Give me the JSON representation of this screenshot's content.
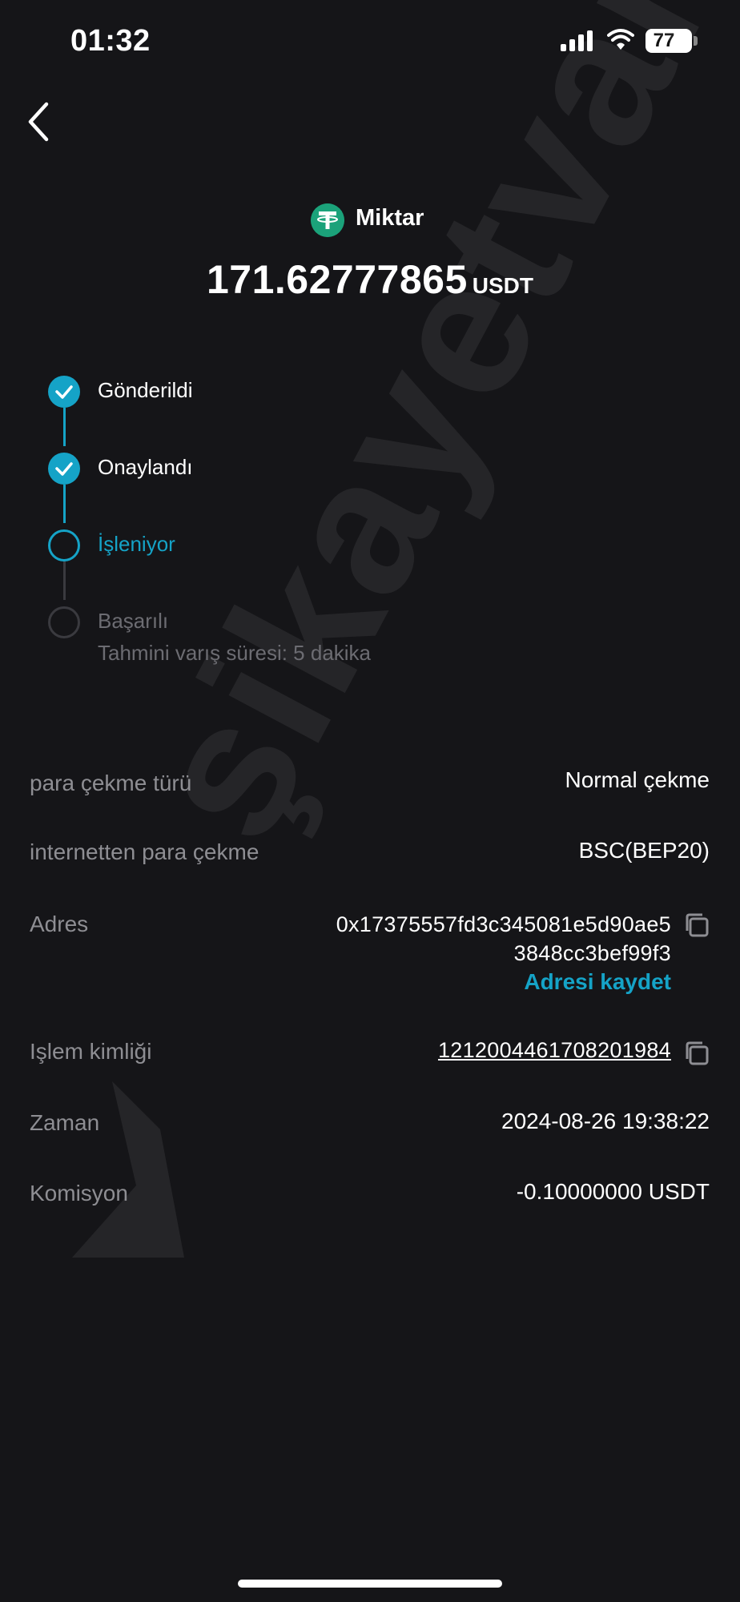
{
  "status_bar": {
    "time": "01:32",
    "battery": "77"
  },
  "header": {
    "coin_label": "Miktar",
    "amount": "171.62777865",
    "unit": "USDT"
  },
  "steps": [
    {
      "label": "Gönderildi",
      "state": "done"
    },
    {
      "label": "Onaylandı",
      "state": "done"
    },
    {
      "label": "İşleniyor",
      "state": "active"
    },
    {
      "label": "Başarılı",
      "sub": "Tahmini varış süresi: 5 dakika",
      "state": "pending"
    }
  ],
  "details": {
    "withdraw_type": {
      "label": "para çekme türü",
      "value": "Normal çekme"
    },
    "network": {
      "label": "internetten para çekme",
      "value": "BSC(BEP20)"
    },
    "address": {
      "label": "Adres",
      "line1": "0x17375557fd3c345081e5d90ae5",
      "line2": "3848cc3bef99f3",
      "save_label": "Adresi kaydet"
    },
    "tx_id": {
      "label": "Işlem kimliği",
      "value": "1212004461708201984"
    },
    "time": {
      "label": "Zaman",
      "value": "2024-08-26 19:38:22"
    },
    "fee": {
      "label": "Komisyon",
      "value": "-0.10000000 USDT"
    }
  },
  "watermark": {
    "text": "şikayetvar"
  },
  "colors": {
    "accent": "#15a3c7",
    "background": "#151518",
    "coin": "#1ba27a"
  }
}
